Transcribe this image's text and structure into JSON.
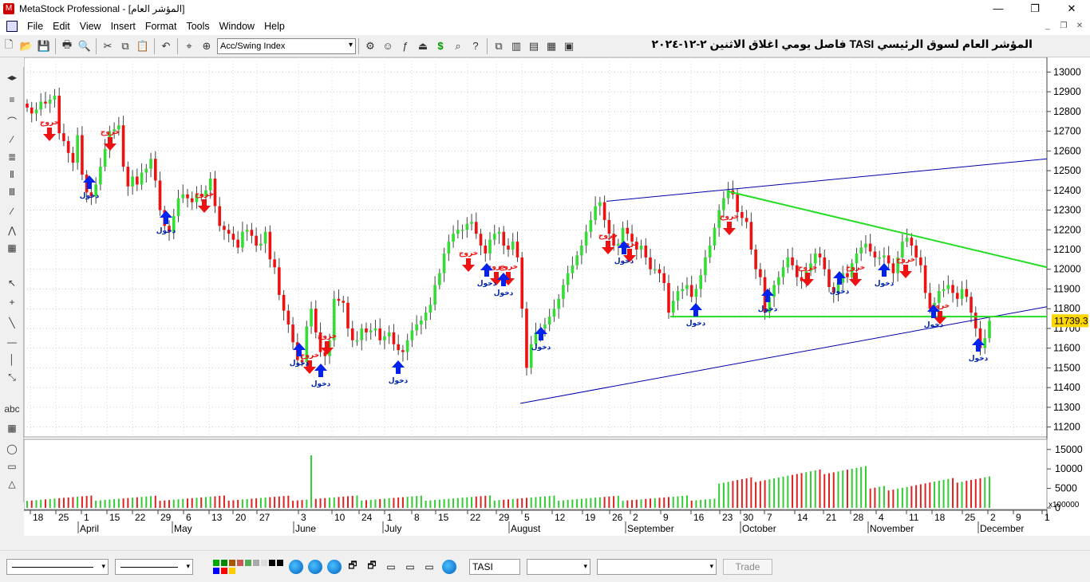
{
  "window": {
    "title": "MetaStock Professional - [المؤشر العام]",
    "minimize": "—",
    "restore": "❐",
    "close": "✕"
  },
  "menu": {
    "items": [
      "File",
      "Edit",
      "View",
      "Insert",
      "Format",
      "Tools",
      "Window",
      "Help"
    ],
    "mdi": [
      "_",
      "❐",
      "✕"
    ]
  },
  "toolbar": {
    "indicator_select": "Acc/Swing Index"
  },
  "chart": {
    "title": "المؤشر العام لسوق الرئيسي TASI فاصل يومي اغلاق الاثنين ٢-١٢-٢٠٢٤",
    "last_price_label": "11739.3",
    "volume_multiplier": "x100000",
    "signal_exit": "خروج",
    "signal_entry": "دخول",
    "colors": {
      "up": "#33dd33",
      "down": "#ee1111",
      "support": "#22dd22",
      "trend": "#0000aa",
      "entry": "#0022ee",
      "exit": "#ee1111"
    }
  },
  "chart_data": {
    "type": "candlestick",
    "price_axis": {
      "min": 11200,
      "max": 13000,
      "ticks": [
        "13000",
        "12900",
        "12800",
        "12700",
        "12600",
        "12500",
        "12400",
        "12300",
        "12200",
        "12100",
        "12000",
        "11900",
        "11800",
        "11700",
        "11600",
        "11500",
        "11400",
        "11300",
        "11200"
      ]
    },
    "volume_axis": {
      "ticks": [
        "15000",
        "10000",
        "5000",
        "0"
      ]
    },
    "x_day_ticks": [
      "18",
      "25",
      "1",
      "15",
      "22",
      "29",
      "6",
      "13",
      "20",
      "27",
      "3",
      "10",
      "24",
      "1",
      "8",
      "15",
      "22",
      "29",
      "5",
      "12",
      "19",
      "26",
      "2",
      "9",
      "16",
      "23",
      "30",
      "7",
      "14",
      "21",
      "28",
      "4",
      "11",
      "18",
      "25",
      "2",
      "9",
      "1"
    ],
    "x_month_labels": [
      "April",
      "May",
      "June",
      "July",
      "August",
      "September",
      "October",
      "November",
      "December"
    ],
    "support_level": 11760,
    "swing_low": 11320,
    "closes": [
      12820,
      12790,
      12810,
      12850,
      12840,
      12860,
      12880,
      12690,
      12650,
      12590,
      12540,
      12680,
      12480,
      12390,
      12370,
      12430,
      12520,
      12610,
      12700,
      12710,
      12730,
      12520,
      12420,
      12470,
      12430,
      12490,
      12510,
      12560,
      12450,
      12300,
      12220,
      12190,
      12270,
      12360,
      12380,
      12360,
      12340,
      12380,
      12370,
      12400,
      12460,
      12320,
      12220,
      12200,
      12180,
      12150,
      12110,
      12190,
      12200,
      12170,
      12120,
      12130,
      12190,
      12050,
      12010,
      11870,
      11790,
      11720,
      11630,
      11540,
      11530,
      11710,
      11800,
      11680,
      11580,
      11560,
      11640,
      11850,
      11840,
      11830,
      11700,
      11640,
      11640,
      11700,
      11680,
      11690,
      11700,
      11640,
      11660,
      11680,
      11620,
      11590,
      11580,
      11640,
      11690,
      11720,
      11740,
      11780,
      11820,
      11920,
      11980,
      12080,
      12140,
      12180,
      12200,
      12200,
      12230,
      12240,
      12180,
      12120,
      12080,
      12150,
      12180,
      12190,
      12120,
      12100,
      12140,
      12060,
      11800,
      11500,
      11620,
      11680,
      11700,
      11720,
      11760,
      11800,
      11850,
      11920,
      11980,
      12020,
      12070,
      12120,
      12190,
      12250,
      12320,
      12340,
      12250,
      12180,
      12120,
      12130,
      12210,
      12180,
      12140,
      12100,
      12120,
      12060,
      12000,
      12000,
      11980,
      11930,
      11780,
      11840,
      11890,
      11900,
      11920,
      11860,
      11900,
      11970,
      12060,
      12120,
      12210,
      12300,
      12360,
      12400,
      12380,
      12290,
      12260,
      12240,
      12100,
      12000,
      11960,
      11780,
      11860,
      11920,
      11960,
      12010,
      12060,
      12020,
      11960,
      11940,
      11990,
      12030,
      12080,
      12060,
      12000,
      11910,
      11880,
      11930,
      11980,
      11960,
      12030,
      12080,
      12110,
      12130,
      12090,
      12060,
      12060,
      12070,
      12030,
      11980,
      12060,
      12140,
      12160,
      12120,
      12060,
      12020,
      11880,
      11800,
      11830,
      11890,
      11900,
      11920,
      11880,
      11850,
      11900,
      11860,
      11780,
      11700,
      11600,
      11650,
      11739
    ]
  },
  "left_tools": [
    "◂▸",
    "≡",
    "⌒",
    "⁄",
    "≣",
    "Ⅱ",
    "Ⅲ",
    "∕",
    "⋀",
    "▦",
    "↖",
    "+",
    "╲",
    "—",
    "│",
    "⤡",
    "abc",
    "▦",
    "◯",
    "▭",
    "△"
  ],
  "status": {
    "symbol": "TASI",
    "trade": "Trade",
    "nav": [
      "⟲",
      "D",
      "✥",
      "⊖",
      "⊕",
      "◀",
      "▶",
      "⇥"
    ]
  }
}
